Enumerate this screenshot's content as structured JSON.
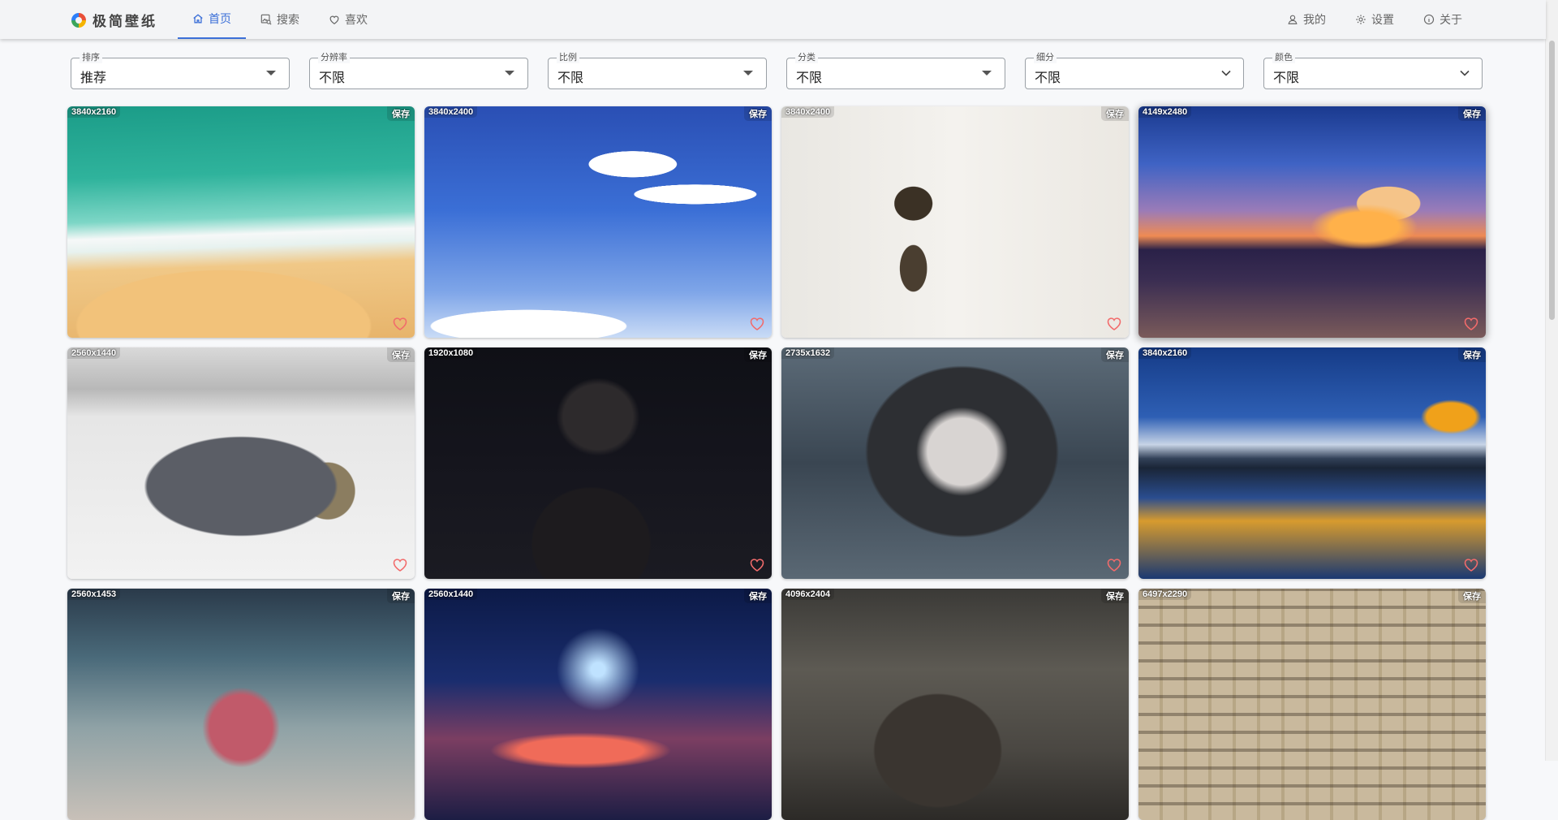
{
  "app": {
    "title": "极简壁纸"
  },
  "nav": {
    "left": [
      {
        "label": "首页",
        "icon": "home-icon",
        "active": true
      },
      {
        "label": "搜索",
        "icon": "image-search-icon",
        "active": false
      },
      {
        "label": "喜欢",
        "icon": "heart-icon",
        "active": false
      }
    ],
    "right": [
      {
        "label": "我的",
        "icon": "user-icon"
      },
      {
        "label": "设置",
        "icon": "gear-icon"
      },
      {
        "label": "关于",
        "icon": "info-icon"
      }
    ]
  },
  "filters": [
    {
      "label": "排序",
      "value": "推荐"
    },
    {
      "label": "分辨率",
      "value": "不限"
    },
    {
      "label": "比例",
      "value": "不限"
    },
    {
      "label": "分类",
      "value": "不限"
    },
    {
      "label": "细分",
      "value": "不限"
    },
    {
      "label": "颜色",
      "value": "不限"
    }
  ],
  "wallpapers": [
    {
      "resolution": "3840x2160",
      "save": "保存"
    },
    {
      "resolution": "3840x2400",
      "save": "保存"
    },
    {
      "resolution": "3840x2400",
      "save": "保存"
    },
    {
      "resolution": "4149x2480",
      "save": "保存"
    },
    {
      "resolution": "2560x1440",
      "save": "保存"
    },
    {
      "resolution": "1920x1080",
      "save": "保存"
    },
    {
      "resolution": "2735x1632",
      "save": "保存"
    },
    {
      "resolution": "3840x2160",
      "save": "保存"
    },
    {
      "resolution": "2560x1453",
      "save": "保存"
    },
    {
      "resolution": "2560x1440",
      "save": "保存"
    },
    {
      "resolution": "4096x2404",
      "save": "保存"
    },
    {
      "resolution": "6497x2290",
      "save": "保存"
    }
  ],
  "colors": {
    "accent": "#3b6fd8",
    "heart": "#f26b6b"
  }
}
